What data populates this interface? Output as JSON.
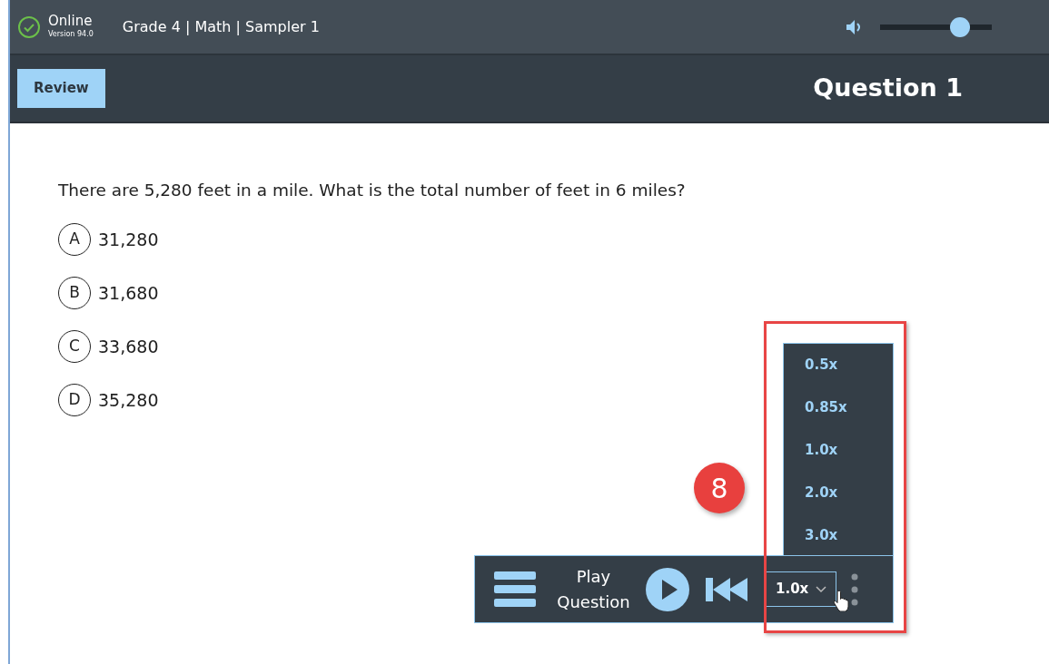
{
  "status": {
    "label": "Online",
    "version": "Version 94.0",
    "online": true
  },
  "test_title": "Grade 4 | Math | Sampler 1",
  "volume": {
    "level": 0.76
  },
  "review_button": "Review",
  "question_title": "Question 1",
  "question": {
    "text": "There are 5,280 feet in a mile. What is the total number of feet in 6 miles?",
    "options": [
      {
        "letter": "A",
        "text": "31,280",
        "selected": false
      },
      {
        "letter": "B",
        "text": "31,680",
        "selected": false
      },
      {
        "letter": "C",
        "text": "33,680",
        "selected": false
      },
      {
        "letter": "D",
        "text": "35,280",
        "selected": false
      }
    ]
  },
  "speed_menu": {
    "open": true,
    "options": [
      {
        "label": "0.5x"
      },
      {
        "label": "0.85x"
      },
      {
        "label": "1.0x"
      },
      {
        "label": "2.0x"
      },
      {
        "label": "3.0x"
      }
    ]
  },
  "player": {
    "label": "Play Question",
    "speed": "1.0x"
  },
  "callout": {
    "number": "8"
  }
}
